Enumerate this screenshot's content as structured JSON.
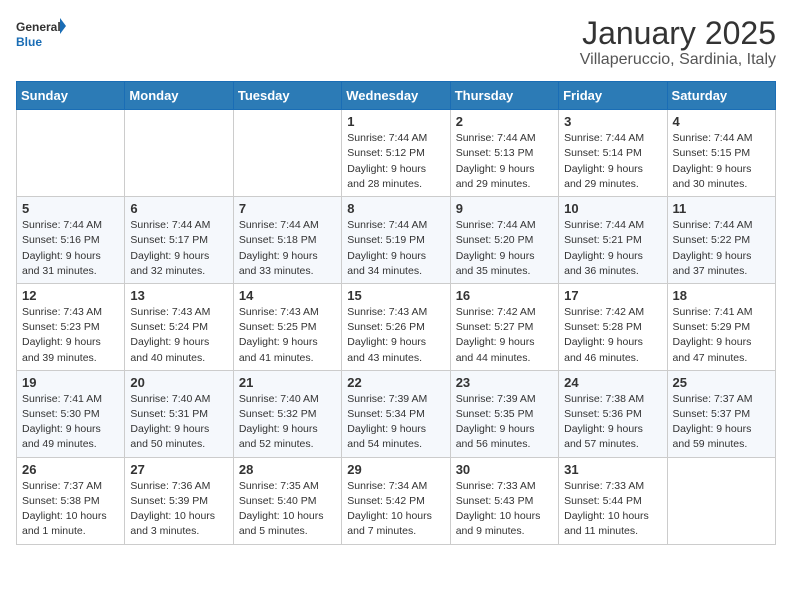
{
  "logo": {
    "general": "General",
    "blue": "Blue"
  },
  "title": "January 2025",
  "subtitle": "Villaperuccio, Sardinia, Italy",
  "weekdays": [
    "Sunday",
    "Monday",
    "Tuesday",
    "Wednesday",
    "Thursday",
    "Friday",
    "Saturday"
  ],
  "weeks": [
    [
      {
        "day": "",
        "info": ""
      },
      {
        "day": "",
        "info": ""
      },
      {
        "day": "",
        "info": ""
      },
      {
        "day": "1",
        "info": "Sunrise: 7:44 AM\nSunset: 5:12 PM\nDaylight: 9 hours and 28 minutes."
      },
      {
        "day": "2",
        "info": "Sunrise: 7:44 AM\nSunset: 5:13 PM\nDaylight: 9 hours and 29 minutes."
      },
      {
        "day": "3",
        "info": "Sunrise: 7:44 AM\nSunset: 5:14 PM\nDaylight: 9 hours and 29 minutes."
      },
      {
        "day": "4",
        "info": "Sunrise: 7:44 AM\nSunset: 5:15 PM\nDaylight: 9 hours and 30 minutes."
      }
    ],
    [
      {
        "day": "5",
        "info": "Sunrise: 7:44 AM\nSunset: 5:16 PM\nDaylight: 9 hours and 31 minutes."
      },
      {
        "day": "6",
        "info": "Sunrise: 7:44 AM\nSunset: 5:17 PM\nDaylight: 9 hours and 32 minutes."
      },
      {
        "day": "7",
        "info": "Sunrise: 7:44 AM\nSunset: 5:18 PM\nDaylight: 9 hours and 33 minutes."
      },
      {
        "day": "8",
        "info": "Sunrise: 7:44 AM\nSunset: 5:19 PM\nDaylight: 9 hours and 34 minutes."
      },
      {
        "day": "9",
        "info": "Sunrise: 7:44 AM\nSunset: 5:20 PM\nDaylight: 9 hours and 35 minutes."
      },
      {
        "day": "10",
        "info": "Sunrise: 7:44 AM\nSunset: 5:21 PM\nDaylight: 9 hours and 36 minutes."
      },
      {
        "day": "11",
        "info": "Sunrise: 7:44 AM\nSunset: 5:22 PM\nDaylight: 9 hours and 37 minutes."
      }
    ],
    [
      {
        "day": "12",
        "info": "Sunrise: 7:43 AM\nSunset: 5:23 PM\nDaylight: 9 hours and 39 minutes."
      },
      {
        "day": "13",
        "info": "Sunrise: 7:43 AM\nSunset: 5:24 PM\nDaylight: 9 hours and 40 minutes."
      },
      {
        "day": "14",
        "info": "Sunrise: 7:43 AM\nSunset: 5:25 PM\nDaylight: 9 hours and 41 minutes."
      },
      {
        "day": "15",
        "info": "Sunrise: 7:43 AM\nSunset: 5:26 PM\nDaylight: 9 hours and 43 minutes."
      },
      {
        "day": "16",
        "info": "Sunrise: 7:42 AM\nSunset: 5:27 PM\nDaylight: 9 hours and 44 minutes."
      },
      {
        "day": "17",
        "info": "Sunrise: 7:42 AM\nSunset: 5:28 PM\nDaylight: 9 hours and 46 minutes."
      },
      {
        "day": "18",
        "info": "Sunrise: 7:41 AM\nSunset: 5:29 PM\nDaylight: 9 hours and 47 minutes."
      }
    ],
    [
      {
        "day": "19",
        "info": "Sunrise: 7:41 AM\nSunset: 5:30 PM\nDaylight: 9 hours and 49 minutes."
      },
      {
        "day": "20",
        "info": "Sunrise: 7:40 AM\nSunset: 5:31 PM\nDaylight: 9 hours and 50 minutes."
      },
      {
        "day": "21",
        "info": "Sunrise: 7:40 AM\nSunset: 5:32 PM\nDaylight: 9 hours and 52 minutes."
      },
      {
        "day": "22",
        "info": "Sunrise: 7:39 AM\nSunset: 5:34 PM\nDaylight: 9 hours and 54 minutes."
      },
      {
        "day": "23",
        "info": "Sunrise: 7:39 AM\nSunset: 5:35 PM\nDaylight: 9 hours and 56 minutes."
      },
      {
        "day": "24",
        "info": "Sunrise: 7:38 AM\nSunset: 5:36 PM\nDaylight: 9 hours and 57 minutes."
      },
      {
        "day": "25",
        "info": "Sunrise: 7:37 AM\nSunset: 5:37 PM\nDaylight: 9 hours and 59 minutes."
      }
    ],
    [
      {
        "day": "26",
        "info": "Sunrise: 7:37 AM\nSunset: 5:38 PM\nDaylight: 10 hours and 1 minute."
      },
      {
        "day": "27",
        "info": "Sunrise: 7:36 AM\nSunset: 5:39 PM\nDaylight: 10 hours and 3 minutes."
      },
      {
        "day": "28",
        "info": "Sunrise: 7:35 AM\nSunset: 5:40 PM\nDaylight: 10 hours and 5 minutes."
      },
      {
        "day": "29",
        "info": "Sunrise: 7:34 AM\nSunset: 5:42 PM\nDaylight: 10 hours and 7 minutes."
      },
      {
        "day": "30",
        "info": "Sunrise: 7:33 AM\nSunset: 5:43 PM\nDaylight: 10 hours and 9 minutes."
      },
      {
        "day": "31",
        "info": "Sunrise: 7:33 AM\nSunset: 5:44 PM\nDaylight: 10 hours and 11 minutes."
      },
      {
        "day": "",
        "info": ""
      }
    ]
  ]
}
